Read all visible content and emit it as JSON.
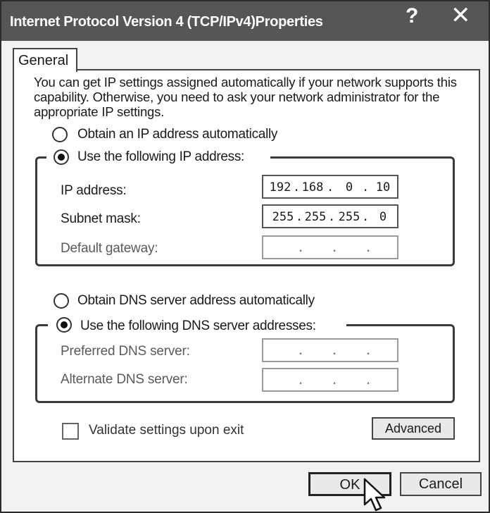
{
  "window": {
    "title": "Internet Protocol Version 4 (TCP/IPv4)Properties",
    "help": "?",
    "close": "✕"
  },
  "tab": {
    "label": "General"
  },
  "description": "You can get IP settings assigned automatically if your network supports this capability. Otherwise, you need to ask your network administrator for the appropriate IP settings.",
  "ip_mode": {
    "auto_label": "Obtain an IP address automatically",
    "manual_label": "Use the following IP address:",
    "selected": "manual"
  },
  "ip_fields": {
    "ip_address": {
      "label": "IP address:",
      "octets": [
        "192",
        "168",
        "0",
        "10"
      ]
    },
    "subnet_mask": {
      "label": "Subnet mask:",
      "octets": [
        "255",
        "255",
        "255",
        "0"
      ]
    },
    "default_gateway": {
      "label": "Default gateway:",
      "octets": [
        "",
        "",
        "",
        ""
      ]
    }
  },
  "dns_mode": {
    "auto_label": "Obtain DNS server address automatically",
    "manual_label": "Use the following DNS server addresses:",
    "selected": "manual"
  },
  "dns_fields": {
    "preferred": {
      "label": "Preferred DNS server:",
      "octets": [
        "",
        "",
        "",
        ""
      ]
    },
    "alternate": {
      "label": "Alternate DNS server:",
      "octets": [
        "",
        "",
        "",
        ""
      ]
    }
  },
  "validate": {
    "label": "Validate settings upon exit",
    "checked": false
  },
  "buttons": {
    "advanced": "Advanced",
    "ok": "OK",
    "cancel": "Cancel"
  },
  "ip_separator": "."
}
